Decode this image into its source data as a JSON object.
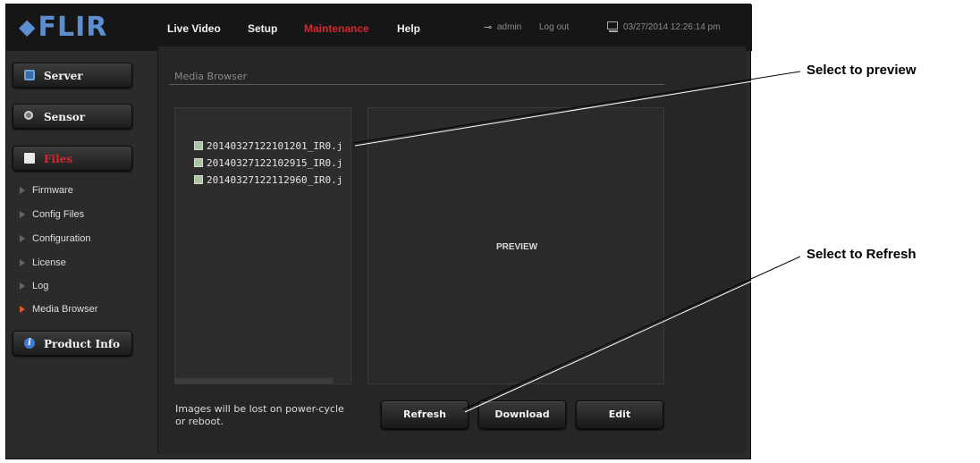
{
  "header": {
    "logo": "FLIR",
    "nav": [
      {
        "label": "Live Video"
      },
      {
        "label": "Setup"
      },
      {
        "label": "Maintenance"
      },
      {
        "label": "Help"
      }
    ],
    "user": "admin",
    "logout": "Log out",
    "datetime": "03/27/2014 12:26:14 pm",
    "active_color": "#d8262c"
  },
  "sidebar": {
    "buttons": [
      {
        "label": "Server",
        "icon": "server-icon"
      },
      {
        "label": "Sensor",
        "icon": "sensor-icon"
      },
      {
        "label": "Files",
        "icon": "files-icon"
      },
      {
        "label": "Product Info",
        "icon": "info-icon"
      }
    ],
    "sub_items": [
      {
        "label": "Firmware"
      },
      {
        "label": "Config Files"
      },
      {
        "label": "Configuration"
      },
      {
        "label": "License"
      },
      {
        "label": "Log"
      },
      {
        "label": "Media Browser"
      }
    ]
  },
  "main": {
    "title": "Media Browser",
    "files": [
      "20140327122101201_IR0.j",
      "20140327122102915_IR0.j",
      "20140327122112960_IR0.j"
    ],
    "preview_label": "PREVIEW",
    "note": "Images will be lost on power-cycle or reboot.",
    "buttons": [
      {
        "label": "Refresh"
      },
      {
        "label": "Download"
      },
      {
        "label": "Edit"
      }
    ]
  },
  "callouts": {
    "preview": "Select to preview",
    "refresh": "Select to Refresh"
  }
}
